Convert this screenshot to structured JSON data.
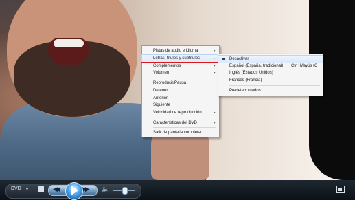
{
  "context_menu": {
    "items": [
      {
        "label": "Pistas de audio e idioma",
        "has_submenu": true
      },
      {
        "label": "Letras, títulos y subtítulos",
        "has_submenu": true
      },
      {
        "label": "Complementos",
        "has_submenu": true
      },
      {
        "label": "Volumen",
        "has_submenu": true
      },
      {
        "label": "Reproducir/Pausa",
        "has_submenu": false
      },
      {
        "label": "Detener",
        "has_submenu": false
      },
      {
        "label": "Anterior",
        "has_submenu": false
      },
      {
        "label": "Siguiente",
        "has_submenu": false
      },
      {
        "label": "Velocidad de reproducción",
        "has_submenu": true
      },
      {
        "label": "Características del DVD",
        "has_submenu": true
      },
      {
        "label": "Salir de pantalla completa",
        "has_submenu": false
      }
    ],
    "highlighted_item": "Letras, títulos y subtítulos",
    "submenu_arrow": "▸"
  },
  "submenu": {
    "items": [
      {
        "label": "Desactivar",
        "shortcut": ""
      },
      {
        "label": "Español (España, tradicional)",
        "shortcut": "Ctrl+Mayús+C"
      },
      {
        "label": "Inglés (Estados Unidos)",
        "shortcut": ""
      },
      {
        "label": "Francés (Francia)",
        "shortcut": ""
      },
      {
        "label": "Predeterminados...",
        "shortcut": ""
      }
    ],
    "selected_item": "Desactivar"
  },
  "controls": {
    "dvd_label": "DVD",
    "dvd_arrow": "▾",
    "prev_glyph": "◀◀",
    "next_glyph": "▶▶",
    "volume_glyph": "🔈",
    "volume_level": 0.55
  },
  "colors": {
    "highlight_outline": "#e0141a",
    "accent_blue": "#4aa3e8"
  },
  "icons": [
    "stop-icon",
    "previous-icon",
    "play-icon",
    "next-icon",
    "volume-icon",
    "fullscreen-icon",
    "dvd-menu-icon"
  ]
}
